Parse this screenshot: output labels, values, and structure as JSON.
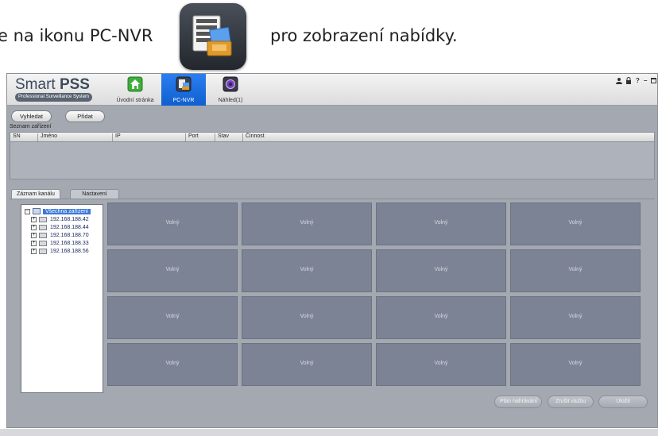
{
  "instruction": {
    "text_before": "e na ikonu PC-NVR",
    "text_after": "pro zobrazení nabídky."
  },
  "app": {
    "logo": {
      "title_light": "Smart ",
      "title_bold": "PSS",
      "subtitle": "Professional Surveillance System"
    },
    "tabs": [
      {
        "label": "Úvodní stránka",
        "icon": "home-icon"
      },
      {
        "label": "PC-NVR",
        "icon": "pc-nvr-icon"
      },
      {
        "label": "Náhled(1)",
        "icon": "camera-icon"
      }
    ],
    "window_controls": [
      "user-icon",
      "lock-icon",
      "help-icon",
      "minimize-icon",
      "maximize-icon"
    ],
    "window_control_glyphs": {
      "help": "?",
      "minimize": "–"
    },
    "toolbar": {
      "search_label": "Vyhledat",
      "add_label": "Přidat"
    },
    "device_list": {
      "title": "Seznam zařízení",
      "columns": [
        "SN",
        "Jméno",
        "IP",
        "Port",
        "Stav",
        "Činnost"
      ],
      "rows": []
    },
    "subtabs": [
      {
        "label": "Záznam kanálu",
        "active": true
      },
      {
        "label": "Nastavení",
        "active": false
      }
    ],
    "tree": {
      "root": "Všechna zařízení",
      "root_expander": "−",
      "child_expander": "+",
      "devices": [
        "192.168.188.42",
        "192.168.188.44",
        "192.168.188.70",
        "192.168.188.33",
        "192.168.188.56"
      ]
    },
    "grid": {
      "cells": [
        "Volný",
        "Volný",
        "Volný",
        "Volný",
        "Volný",
        "Volný",
        "Volný",
        "Volný",
        "Volný",
        "Volný",
        "Volný",
        "Volný",
        "Volný",
        "Volný",
        "Volný",
        "Volný"
      ]
    },
    "footer_buttons": {
      "plan_label": "Plán nahrávání",
      "unbind_label": "Zrušit vazbu",
      "save_label": "Uložit"
    }
  },
  "colors": {
    "accent": "#1565d8",
    "background": "#a4a8b0",
    "cell": "#7c8394"
  }
}
